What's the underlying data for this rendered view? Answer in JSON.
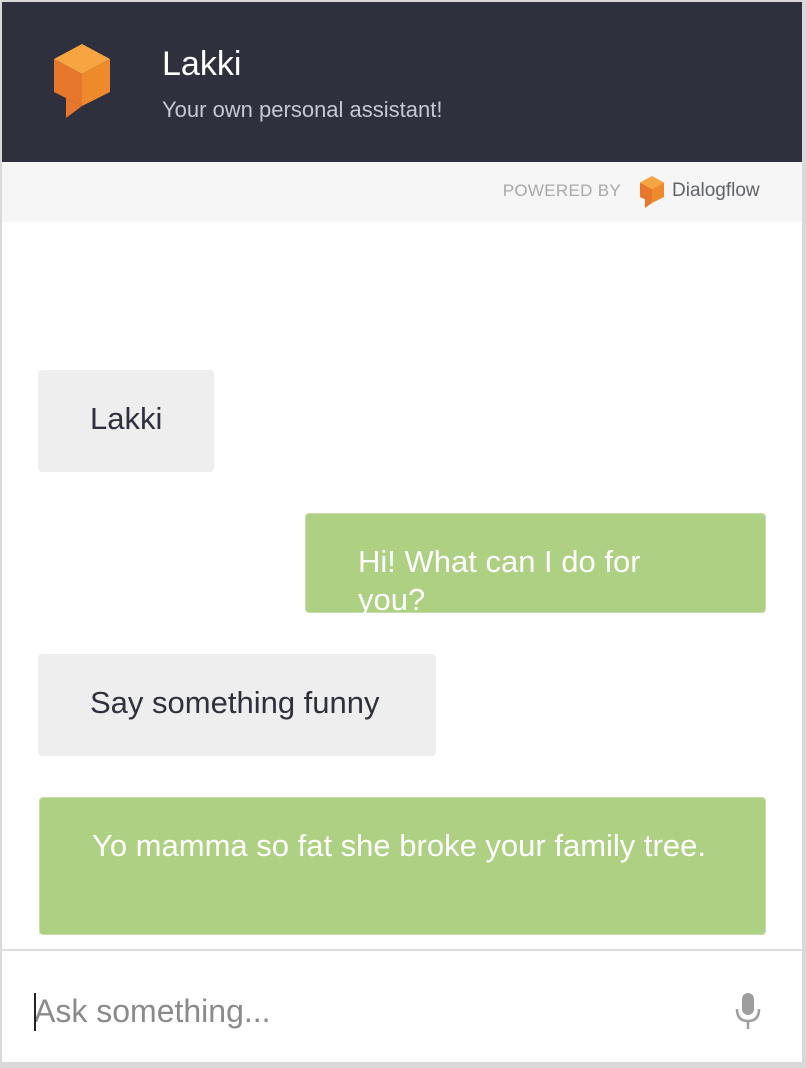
{
  "header": {
    "agent_name": "Lakki",
    "agent_description": "Your own personal assistant!",
    "logo_icon": "dialogflow-cube-icon"
  },
  "powered_by": {
    "label": "POWERED BY",
    "brand_name": "Dialogflow",
    "brand_icon": "dialogflow-cube-icon"
  },
  "messages": [
    {
      "role": "user",
      "text": "Lakki"
    },
    {
      "role": "agent",
      "text": "Hi! What can I do for you?"
    },
    {
      "role": "user",
      "text": "Say something funny"
    },
    {
      "role": "agent",
      "text": "Yo mamma so fat she broke your family tree."
    }
  ],
  "input": {
    "placeholder": "Ask something...",
    "value": "",
    "mic_icon": "microphone-icon"
  },
  "colors": {
    "header_bg": "#2e313d",
    "agent_bubble": "#add082",
    "user_bubble": "#eeeeee",
    "brand_orange": "#ef8a2c"
  }
}
